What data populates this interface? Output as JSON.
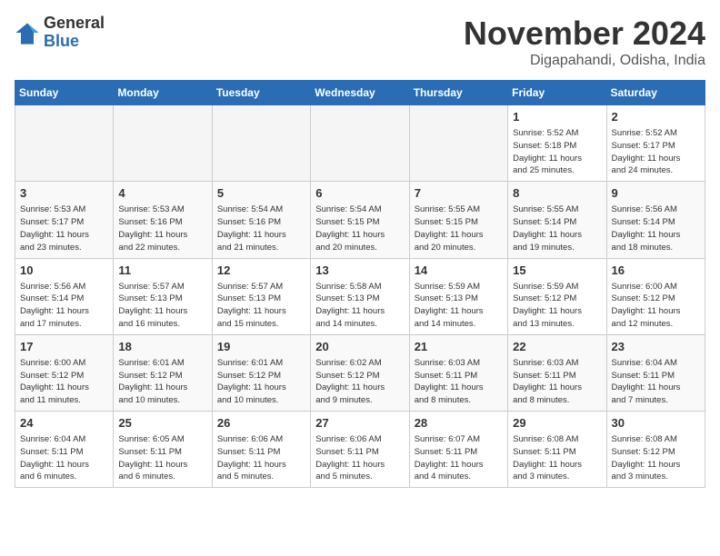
{
  "header": {
    "logo_general": "General",
    "logo_blue": "Blue",
    "title": "November 2024",
    "location": "Digapahandi, Odisha, India"
  },
  "weekdays": [
    "Sunday",
    "Monday",
    "Tuesday",
    "Wednesday",
    "Thursday",
    "Friday",
    "Saturday"
  ],
  "weeks": [
    [
      {
        "day": "",
        "info": ""
      },
      {
        "day": "",
        "info": ""
      },
      {
        "day": "",
        "info": ""
      },
      {
        "day": "",
        "info": ""
      },
      {
        "day": "",
        "info": ""
      },
      {
        "day": "1",
        "info": "Sunrise: 5:52 AM\nSunset: 5:18 PM\nDaylight: 11 hours\nand 25 minutes."
      },
      {
        "day": "2",
        "info": "Sunrise: 5:52 AM\nSunset: 5:17 PM\nDaylight: 11 hours\nand 24 minutes."
      }
    ],
    [
      {
        "day": "3",
        "info": "Sunrise: 5:53 AM\nSunset: 5:17 PM\nDaylight: 11 hours\nand 23 minutes."
      },
      {
        "day": "4",
        "info": "Sunrise: 5:53 AM\nSunset: 5:16 PM\nDaylight: 11 hours\nand 22 minutes."
      },
      {
        "day": "5",
        "info": "Sunrise: 5:54 AM\nSunset: 5:16 PM\nDaylight: 11 hours\nand 21 minutes."
      },
      {
        "day": "6",
        "info": "Sunrise: 5:54 AM\nSunset: 5:15 PM\nDaylight: 11 hours\nand 20 minutes."
      },
      {
        "day": "7",
        "info": "Sunrise: 5:55 AM\nSunset: 5:15 PM\nDaylight: 11 hours\nand 20 minutes."
      },
      {
        "day": "8",
        "info": "Sunrise: 5:55 AM\nSunset: 5:14 PM\nDaylight: 11 hours\nand 19 minutes."
      },
      {
        "day": "9",
        "info": "Sunrise: 5:56 AM\nSunset: 5:14 PM\nDaylight: 11 hours\nand 18 minutes."
      }
    ],
    [
      {
        "day": "10",
        "info": "Sunrise: 5:56 AM\nSunset: 5:14 PM\nDaylight: 11 hours\nand 17 minutes."
      },
      {
        "day": "11",
        "info": "Sunrise: 5:57 AM\nSunset: 5:13 PM\nDaylight: 11 hours\nand 16 minutes."
      },
      {
        "day": "12",
        "info": "Sunrise: 5:57 AM\nSunset: 5:13 PM\nDaylight: 11 hours\nand 15 minutes."
      },
      {
        "day": "13",
        "info": "Sunrise: 5:58 AM\nSunset: 5:13 PM\nDaylight: 11 hours\nand 14 minutes."
      },
      {
        "day": "14",
        "info": "Sunrise: 5:59 AM\nSunset: 5:13 PM\nDaylight: 11 hours\nand 14 minutes."
      },
      {
        "day": "15",
        "info": "Sunrise: 5:59 AM\nSunset: 5:12 PM\nDaylight: 11 hours\nand 13 minutes."
      },
      {
        "day": "16",
        "info": "Sunrise: 6:00 AM\nSunset: 5:12 PM\nDaylight: 11 hours\nand 12 minutes."
      }
    ],
    [
      {
        "day": "17",
        "info": "Sunrise: 6:00 AM\nSunset: 5:12 PM\nDaylight: 11 hours\nand 11 minutes."
      },
      {
        "day": "18",
        "info": "Sunrise: 6:01 AM\nSunset: 5:12 PM\nDaylight: 11 hours\nand 10 minutes."
      },
      {
        "day": "19",
        "info": "Sunrise: 6:01 AM\nSunset: 5:12 PM\nDaylight: 11 hours\nand 10 minutes."
      },
      {
        "day": "20",
        "info": "Sunrise: 6:02 AM\nSunset: 5:12 PM\nDaylight: 11 hours\nand 9 minutes."
      },
      {
        "day": "21",
        "info": "Sunrise: 6:03 AM\nSunset: 5:11 PM\nDaylight: 11 hours\nand 8 minutes."
      },
      {
        "day": "22",
        "info": "Sunrise: 6:03 AM\nSunset: 5:11 PM\nDaylight: 11 hours\nand 8 minutes."
      },
      {
        "day": "23",
        "info": "Sunrise: 6:04 AM\nSunset: 5:11 PM\nDaylight: 11 hours\nand 7 minutes."
      }
    ],
    [
      {
        "day": "24",
        "info": "Sunrise: 6:04 AM\nSunset: 5:11 PM\nDaylight: 11 hours\nand 6 minutes."
      },
      {
        "day": "25",
        "info": "Sunrise: 6:05 AM\nSunset: 5:11 PM\nDaylight: 11 hours\nand 6 minutes."
      },
      {
        "day": "26",
        "info": "Sunrise: 6:06 AM\nSunset: 5:11 PM\nDaylight: 11 hours\nand 5 minutes."
      },
      {
        "day": "27",
        "info": "Sunrise: 6:06 AM\nSunset: 5:11 PM\nDaylight: 11 hours\nand 5 minutes."
      },
      {
        "day": "28",
        "info": "Sunrise: 6:07 AM\nSunset: 5:11 PM\nDaylight: 11 hours\nand 4 minutes."
      },
      {
        "day": "29",
        "info": "Sunrise: 6:08 AM\nSunset: 5:11 PM\nDaylight: 11 hours\nand 3 minutes."
      },
      {
        "day": "30",
        "info": "Sunrise: 6:08 AM\nSunset: 5:12 PM\nDaylight: 11 hours\nand 3 minutes."
      }
    ]
  ]
}
